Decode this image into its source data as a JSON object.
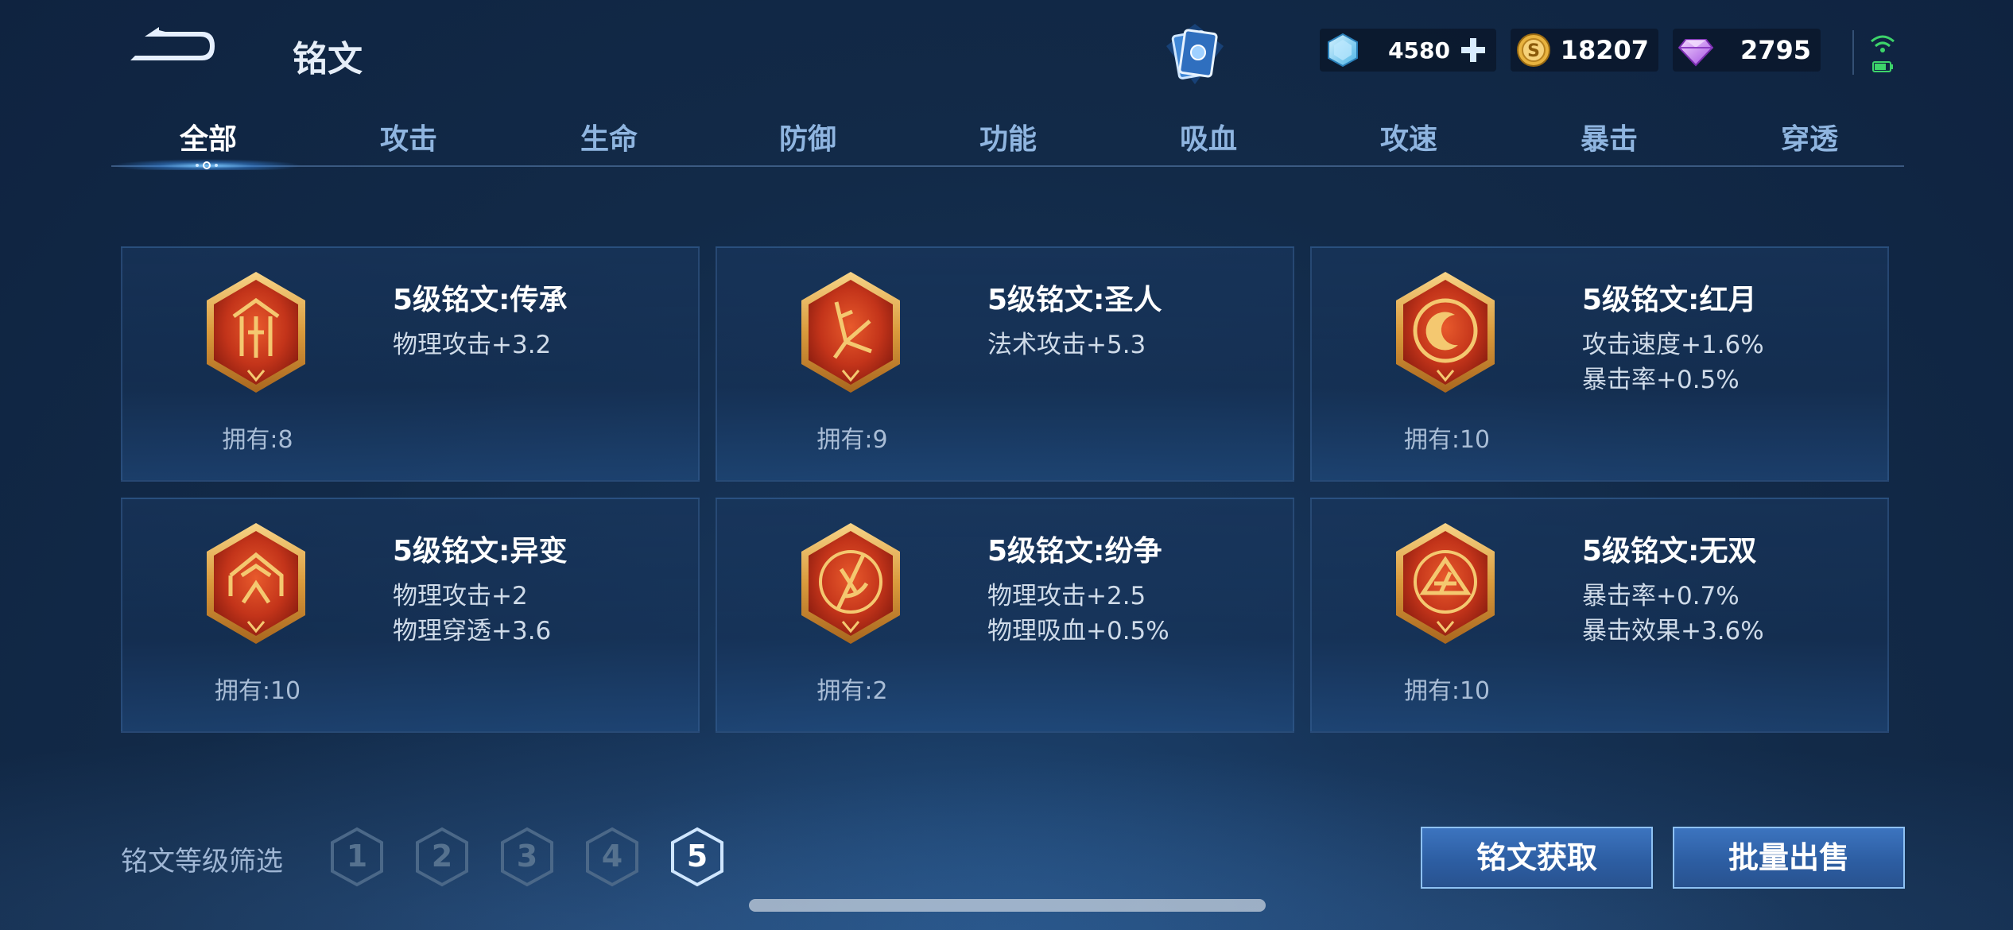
{
  "header": {
    "title": "铭文",
    "currencies": [
      {
        "icon": "crystal-icon",
        "value": "4580"
      },
      {
        "icon": "gold-coin-icon",
        "value": "18207"
      },
      {
        "icon": "diamond-icon",
        "value": "2795"
      }
    ]
  },
  "tabs": [
    {
      "label": "全部",
      "active": true
    },
    {
      "label": "攻击"
    },
    {
      "label": "生命"
    },
    {
      "label": "防御"
    },
    {
      "label": "功能"
    },
    {
      "label": "吸血"
    },
    {
      "label": "攻速"
    },
    {
      "label": "暴击"
    },
    {
      "label": "穿透"
    }
  ],
  "runes": [
    {
      "name": "5级铭文:传承",
      "stats": [
        "物理攻击+3.2"
      ],
      "owned": "拥有:8"
    },
    {
      "name": "5级铭文:圣人",
      "stats": [
        "法术攻击+5.3"
      ],
      "owned": "拥有:9"
    },
    {
      "name": "5级铭文:红月",
      "stats": [
        "攻击速度+1.6%",
        "暴击率+0.5%"
      ],
      "owned": "拥有:10"
    },
    {
      "name": "5级铭文:异变",
      "stats": [
        "物理攻击+2",
        "物理穿透+3.6"
      ],
      "owned": "拥有:10"
    },
    {
      "name": "5级铭文:纷争",
      "stats": [
        "物理攻击+2.5",
        "物理吸血+0.5%"
      ],
      "owned": "拥有:2"
    },
    {
      "name": "5级铭文:无双",
      "stats": [
        "暴击率+0.7%",
        "暴击效果+3.6%"
      ],
      "owned": "拥有:10"
    }
  ],
  "footer": {
    "filter_label": "铭文等级筛选",
    "levels": [
      "1",
      "2",
      "3",
      "4",
      "5"
    ],
    "active_level": "5",
    "acquire_label": "铭文获取",
    "sell_label": "批量出售"
  },
  "colors": {
    "rune_red": "#c7361c",
    "rune_gold": "#e6a443",
    "button_blue": "#2d5ea3"
  }
}
